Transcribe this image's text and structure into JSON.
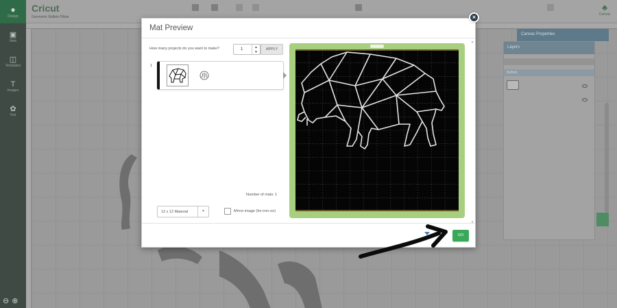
{
  "app": {
    "brand": "Cricut",
    "project_name": "Geometric Buffalo Pillow",
    "rail_top_label": "Design",
    "rail_items": [
      {
        "icon": "shirt-icon",
        "label": "New"
      },
      {
        "icon": "templates-icon",
        "label": "Templates"
      },
      {
        "icon": "images-icon",
        "label": "Images"
      },
      {
        "icon": "text-icon",
        "label": "Text"
      },
      {
        "icon": "shapes-icon",
        "label": "Shapes"
      }
    ],
    "zoom_out": "−",
    "zoom_in": "+",
    "canvas_tab_label": "Canvas",
    "props_panel_title": "Canvas Properties",
    "layers_panel_title": "Layers",
    "layers_group_label": "Buffalo"
  },
  "modal": {
    "title": "Mat Preview",
    "close": "×",
    "quantity_label": "How many projects do you want to make?",
    "quantity_value": "1",
    "stepper_up": "▲",
    "stepper_down": "▼",
    "apply_label": "APPLY",
    "mat_index": "1",
    "number_of_mats_label": "Number of mats:  1",
    "material_label": "12 x 12 Material",
    "material_caret": "▼",
    "mirror_label": "Mirror image (for iron-on)",
    "scroll_up": "▲",
    "scroll_down": "▼",
    "go_label": "GO"
  },
  "colors": {
    "mat_green": "#a8cf7f",
    "mat_black": "#050505",
    "go_green": "#3aa957",
    "modal_close": "#2c3b47"
  }
}
